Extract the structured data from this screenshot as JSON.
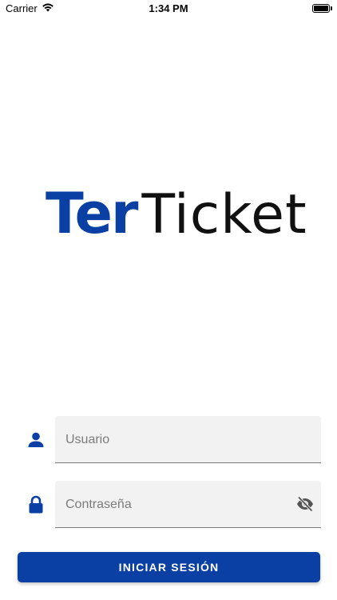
{
  "status_bar": {
    "carrier": "Carrier",
    "time": "1:34 PM",
    "wifi_icon": "wifi-icon",
    "battery_icon": "battery-icon"
  },
  "logo": {
    "part1": "Ter",
    "part2": "Ticket",
    "part1_color": "#0a3fa3",
    "part2_color": "#111111"
  },
  "form": {
    "username": {
      "placeholder": "Usuario",
      "value": "",
      "icon": "user-icon"
    },
    "password": {
      "placeholder": "Contraseña",
      "value": "",
      "icon": "lock-icon",
      "toggle_icon": "eye-off-icon"
    },
    "submit_label": "INICIAR SESIÓN"
  },
  "colors": {
    "brand": "#0a3fa3",
    "field_background": "#f2f2f2",
    "icon": "#0a3fa3"
  }
}
